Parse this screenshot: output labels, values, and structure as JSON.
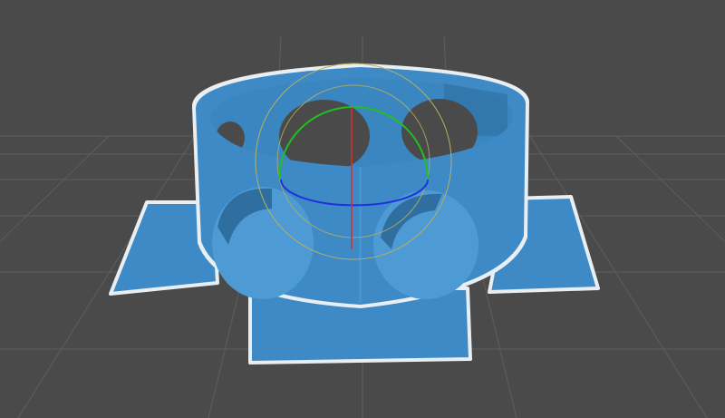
{
  "viewport": {
    "background_color": "#4a4a4a",
    "grid_color": "#5c5c5c",
    "model_color": "#3d8ac6",
    "model_shadow_color": "#2f6f9f",
    "model_highlight_color": "#5aa6de",
    "outline_color": "#e8eef2"
  },
  "gizmo": {
    "x_axis_color": "#d03030",
    "y_axis_color": "#20c020",
    "z_axis_color": "#2030e0",
    "ring_color": "#b8b060"
  }
}
